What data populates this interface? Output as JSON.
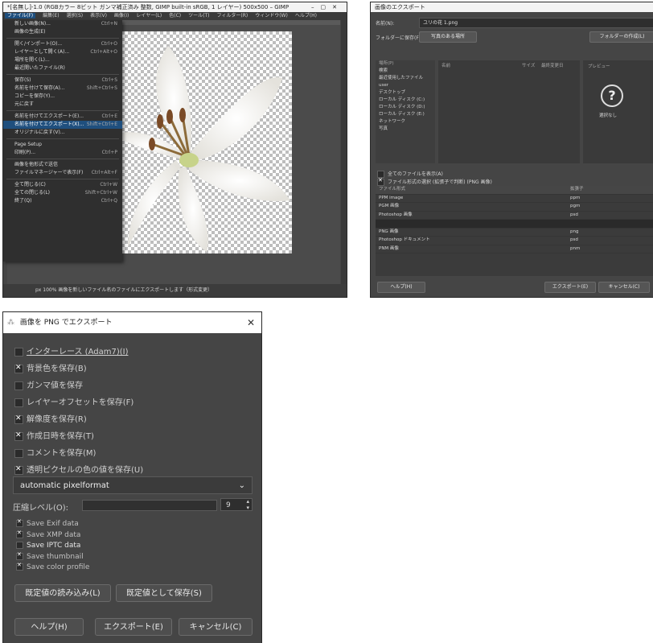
{
  "gimp": {
    "title": "*[名無し]-1.0 (RGBカラー 8ビット ガンマ補正済み 整数, GIMP built-in sRGB, 1 レイヤー) 500x500 – GIMP",
    "menubar": [
      "ファイル(F)",
      "編集(E)",
      "選択(S)",
      "表示(V)",
      "画像(I)",
      "レイヤー(L)",
      "色(C)",
      "ツール(T)",
      "フィルター(R)",
      "ウィンドウ(W)",
      "ヘルプ(H)"
    ],
    "menu_items": [
      {
        "label": "新しい画像(N)...",
        "shortcut": "Ctrl+N"
      },
      {
        "label": "画像の生成(E)",
        "shortcut": ""
      },
      {
        "label": "開く/インポート(O)...",
        "shortcut": "Ctrl+O"
      },
      {
        "label": "レイヤーとして開く(A)...",
        "shortcut": "Ctrl+Alt+O"
      },
      {
        "label": "場所を開く(L)...",
        "shortcut": ""
      },
      {
        "label": "最近開いたファイル(R)",
        "shortcut": ""
      },
      {
        "label": "保存(S)",
        "shortcut": "Ctrl+S"
      },
      {
        "label": "名前を付けて保存(A)...",
        "shortcut": "Shift+Ctrl+S"
      },
      {
        "label": "コピーを保存(Y)...",
        "shortcut": ""
      },
      {
        "label": "元に戻す",
        "shortcut": ""
      },
      {
        "label": "名前を付けてエクスポート(E)...",
        "shortcut": "Ctrl+E"
      },
      {
        "label": "名前を付けてエクスポート(X)...",
        "shortcut": "Shift+Ctrl+E"
      },
      {
        "label": "オリジナルに戻す(V)...",
        "shortcut": ""
      },
      {
        "label": "Page Setup",
        "shortcut": ""
      },
      {
        "label": "印刷(P)...",
        "shortcut": "Ctrl+P"
      },
      {
        "label": "画像を他形式で送信",
        "shortcut": ""
      },
      {
        "label": "ファイルマネージャーで表示(F)",
        "shortcut": "Ctrl+Alt+F"
      },
      {
        "label": "全て閉じる(C)",
        "shortcut": "Ctrl+W"
      },
      {
        "label": "全ての閉じる(L)",
        "shortcut": "Shift+Ctrl+W"
      },
      {
        "label": "終了(Q)",
        "shortcut": "Ctrl+Q"
      }
    ],
    "highlighted_index": 11,
    "status": "px  100%  画像を新しいファイル名のファイルにエクスポートします（形式変更）"
  },
  "export": {
    "title": "画像のエクスポート",
    "name_label": "名前(N):",
    "name_value": "ユリの花 1.png",
    "folder_label": "フォルダーに保存(F):",
    "folder_value": "写真のある場所",
    "create_folder": "フォルダーの作成(L)",
    "places_header": "場所(P)",
    "places": [
      "検索",
      "最近使用したファイル",
      "user",
      "デスクトップ",
      "ローカル ディスク (C:)",
      "ローカル ディスク (D:)",
      "ローカル ディスク (E:)",
      "ネットワーク",
      "写真"
    ],
    "list_headers": [
      "名前",
      "サイズ",
      "最終変更日"
    ],
    "preview_label": "プレビュー",
    "preview_text": "選択なし",
    "show_all": "全てのファイルを表示(A)",
    "filetype_toggle": "ファイル形式の選択 (拡張子で判断) (PNG 画像)",
    "filetype_headers": [
      "ファイル形式",
      "拡張子"
    ],
    "filetypes": [
      {
        "name": "PPM image",
        "ext": "ppm"
      },
      {
        "name": "PGM 画像",
        "ext": "pgm"
      },
      {
        "name": "Photoshop 画像",
        "ext": "psd"
      },
      {
        "name": "",
        "ext": ""
      },
      {
        "name": "PNG 画像",
        "ext": "png"
      },
      {
        "name": "Photoshop ドキュメント",
        "ext": "psd"
      },
      {
        "name": "PNM 画像",
        "ext": "pnm"
      }
    ],
    "help": "ヘルプ(H)",
    "export_btn": "エクスポート(E)",
    "cancel_btn": "キャンセル(C)"
  },
  "png": {
    "title": "画像を PNG でエクスポート",
    "options": [
      {
        "label": "インターレース (Adam7)(I)",
        "checked": false
      },
      {
        "label": "背景色を保存(B)",
        "checked": true
      },
      {
        "label": "ガンマ値を保存",
        "checked": false
      },
      {
        "label": "レイヤーオフセットを保存(F)",
        "checked": false
      },
      {
        "label": "解像度を保存(R)",
        "checked": true
      },
      {
        "label": "作成日時を保存(T)",
        "checked": true
      },
      {
        "label": "コメントを保存(M)",
        "checked": false
      },
      {
        "label": "透明ピクセルの色の値を保存(U)",
        "checked": true
      }
    ],
    "format": "automatic pixelformat",
    "compression_label": "圧縮レベル(O):",
    "compression_value": "9",
    "meta_options": [
      {
        "label": "Save Exif data",
        "checked": true
      },
      {
        "label": "Save XMP data",
        "checked": true
      },
      {
        "label": "Save IPTC data",
        "checked": false
      },
      {
        "label": "Save thumbnail",
        "checked": true
      },
      {
        "label": "Save color profile",
        "checked": true
      }
    ],
    "load_defaults": "既定値の読み込み(L)",
    "save_defaults": "既定値として保存(S)",
    "help": "ヘルプ(H)",
    "export": "エクスポート(E)",
    "cancel": "キャンセル(C)",
    "close_glyph": "✕"
  }
}
